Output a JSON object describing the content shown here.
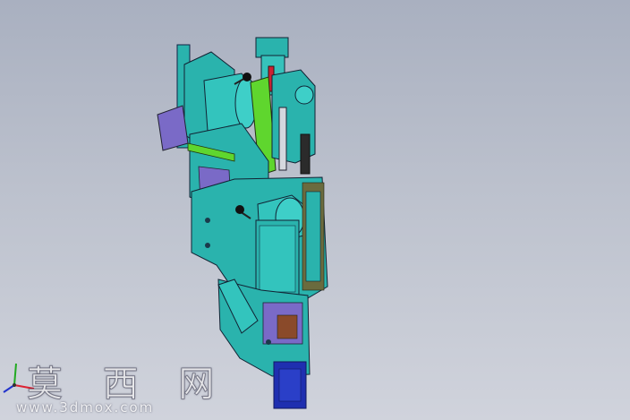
{
  "watermark": {
    "chars": "莫 西 网",
    "url": "www.3dmox.com"
  },
  "scene": {
    "background_top": "#a9b0c0",
    "background_bottom": "#d0d3dc",
    "model_primary_color": "#2ab3ad",
    "model_highlight_color": "#3ecfc8",
    "accent_green": "#5fd62e",
    "accent_purple": "#7a6ac7",
    "base_blue": "#1f2fb0"
  },
  "triad": {
    "x_axis_color": "#d23",
    "y_axis_color": "#2a2",
    "z_axis_color": "#23c"
  }
}
